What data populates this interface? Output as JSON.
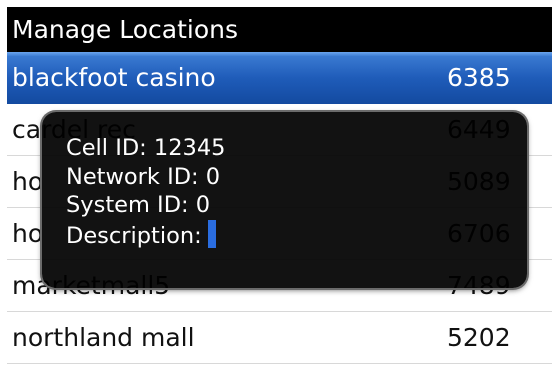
{
  "title": "Manage Locations",
  "locations": [
    {
      "name": "blackfoot casino",
      "code": "6385",
      "selected": true
    },
    {
      "name": "cardel rec",
      "code": "6449"
    },
    {
      "name": "ho",
      "code": "5089"
    },
    {
      "name": "ho",
      "code": "6706"
    },
    {
      "name": "marketmall5",
      "code": "7489"
    },
    {
      "name": "northland mall",
      "code": "5202"
    }
  ],
  "popup": {
    "cell_id": "Cell ID: 12345",
    "network_id": "Network ID: 0",
    "system_id": "System ID: 0",
    "description": "Description:"
  },
  "colors": {
    "selection": "#1f5cb9",
    "titlebar": "#000000",
    "cursor": "#2a6de0"
  }
}
